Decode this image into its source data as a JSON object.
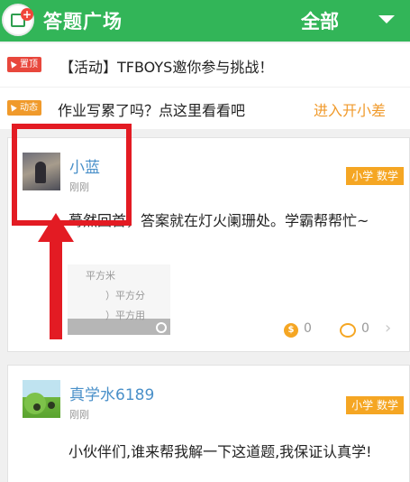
{
  "header": {
    "title": "答题广场",
    "filter_label": "全部"
  },
  "notices": [
    {
      "tag": "置顶",
      "text": "【活动】TFBOYS邀你参与挑战！"
    },
    {
      "tag": "动态",
      "text": "作业写累了吗？点这里看看吧",
      "link": "进入开小差"
    }
  ],
  "posts": [
    {
      "username": "小蓝",
      "time": "刚刚",
      "subject": "小学 数学",
      "content": "蓦然回首，答案就在灯火阑珊处。学霸帮帮忙~",
      "thumbnail_lines": [
        "平方米",
        "）平方分",
        "）平方用"
      ],
      "coin_count": "0",
      "comment_count": "0"
    },
    {
      "username": "真学水6189",
      "time": "刚刚",
      "subject": "小学 数学",
      "content": "小伙伴们,谁来帮我解一下这道题,我保证认真学!"
    }
  ],
  "colors": {
    "brand_green": "#32b558",
    "accent_orange": "#f5a623",
    "annotation_red": "#e31b23"
  }
}
